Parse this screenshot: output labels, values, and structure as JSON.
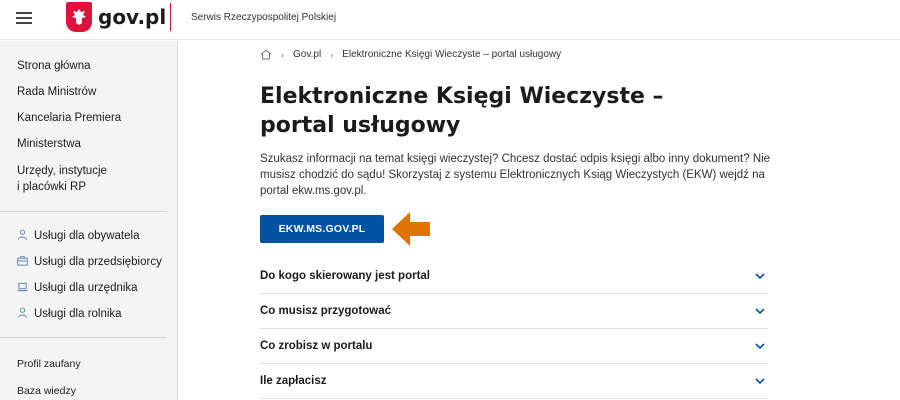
{
  "header": {
    "logo_text": "gov.pl",
    "service_name": "Serwis Rzeczypospolitej Polskiej",
    "brand_color": "#dc143c"
  },
  "sidebar": {
    "main_items": [
      {
        "label": "Strona główna"
      },
      {
        "label": "Rada Ministrów"
      },
      {
        "label": "Kancelaria Premiera"
      },
      {
        "label": "Ministerstwa"
      },
      {
        "label": "Urzędy, instytucje"
      },
      {
        "label": "i placówki RP"
      }
    ],
    "service_items": [
      {
        "label": "Usługi dla obywatela",
        "icon": "person-icon"
      },
      {
        "label": "Usługi dla przedsiębiorcy",
        "icon": "briefcase-icon"
      },
      {
        "label": "Usługi dla urzędnika",
        "icon": "laptop-icon"
      },
      {
        "label": "Usługi dla rolnika",
        "icon": "person-icon"
      }
    ],
    "extra_items": [
      {
        "label": "Profil zaufany"
      },
      {
        "label": "Baza wiedzy"
      }
    ]
  },
  "breadcrumb": {
    "home_icon": "home-icon",
    "items": [
      {
        "label": "Gov.pl"
      },
      {
        "label": "Elektroniczne Księgi Wieczyste – portal usługowy"
      }
    ]
  },
  "main": {
    "title": "Elektroniczne Księgi Wieczyste – portal usługowy",
    "intro": "Szukasz informacji na temat księgi wieczystej? Chcesz dostać odpis księgi albo inny dokument? Nie musisz chodzić do sądu! Skorzystaj z systemu Elektronicznych Ksiąg Wieczystych (EKW) wejdź na portal ekw.ms.gov.pl.",
    "cta_label": "EKW.MS.GOV.PL",
    "cta_color": "#0052a5",
    "arrow_color": "#e07400",
    "accordion": [
      {
        "label": "Do kogo skierowany jest portal"
      },
      {
        "label": "Co musisz przygotować"
      },
      {
        "label": "Co zrobisz w portalu"
      },
      {
        "label": "Ile zapłacisz"
      }
    ]
  }
}
